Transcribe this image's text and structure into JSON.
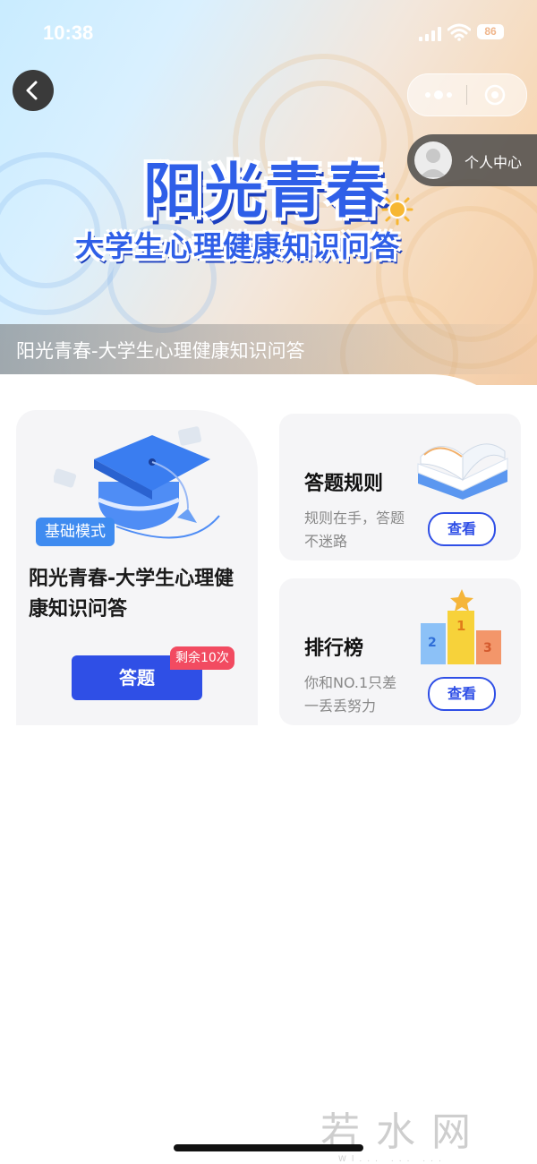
{
  "status_bar": {
    "time": "10:38",
    "battery": "86"
  },
  "header": {
    "profile_label": "个人中心",
    "title_main": "阳光青春",
    "title_sub": "大学生心理健康知识问答",
    "banner_text": "阳光青春-大学生心理健康知识问答"
  },
  "main_card": {
    "mode_badge": "基础模式",
    "title": "阳光青春-大学生心理健康知识问答",
    "answer_button": "答题",
    "remaining_badge": "剩余10次"
  },
  "rules_card": {
    "title": "答题规则",
    "description": "规则在手，答题不迷路",
    "button": "查看"
  },
  "ranking_card": {
    "title": "排行榜",
    "description": "你和NO.1只差一丢丢努力",
    "button": "查看"
  },
  "watermark": {
    "text": "若水网",
    "sub": "Wl... ... ..."
  },
  "colors": {
    "primary_blue": "#2f4fe6",
    "badge_blue": "#3f8bf0",
    "remain_red": "#f24b61"
  },
  "icons": [
    "back-icon",
    "more-dots-icon",
    "target-icon",
    "user-avatar-icon",
    "sun-icon",
    "graduation-cap-icon",
    "book-icon",
    "podium-icon"
  ]
}
